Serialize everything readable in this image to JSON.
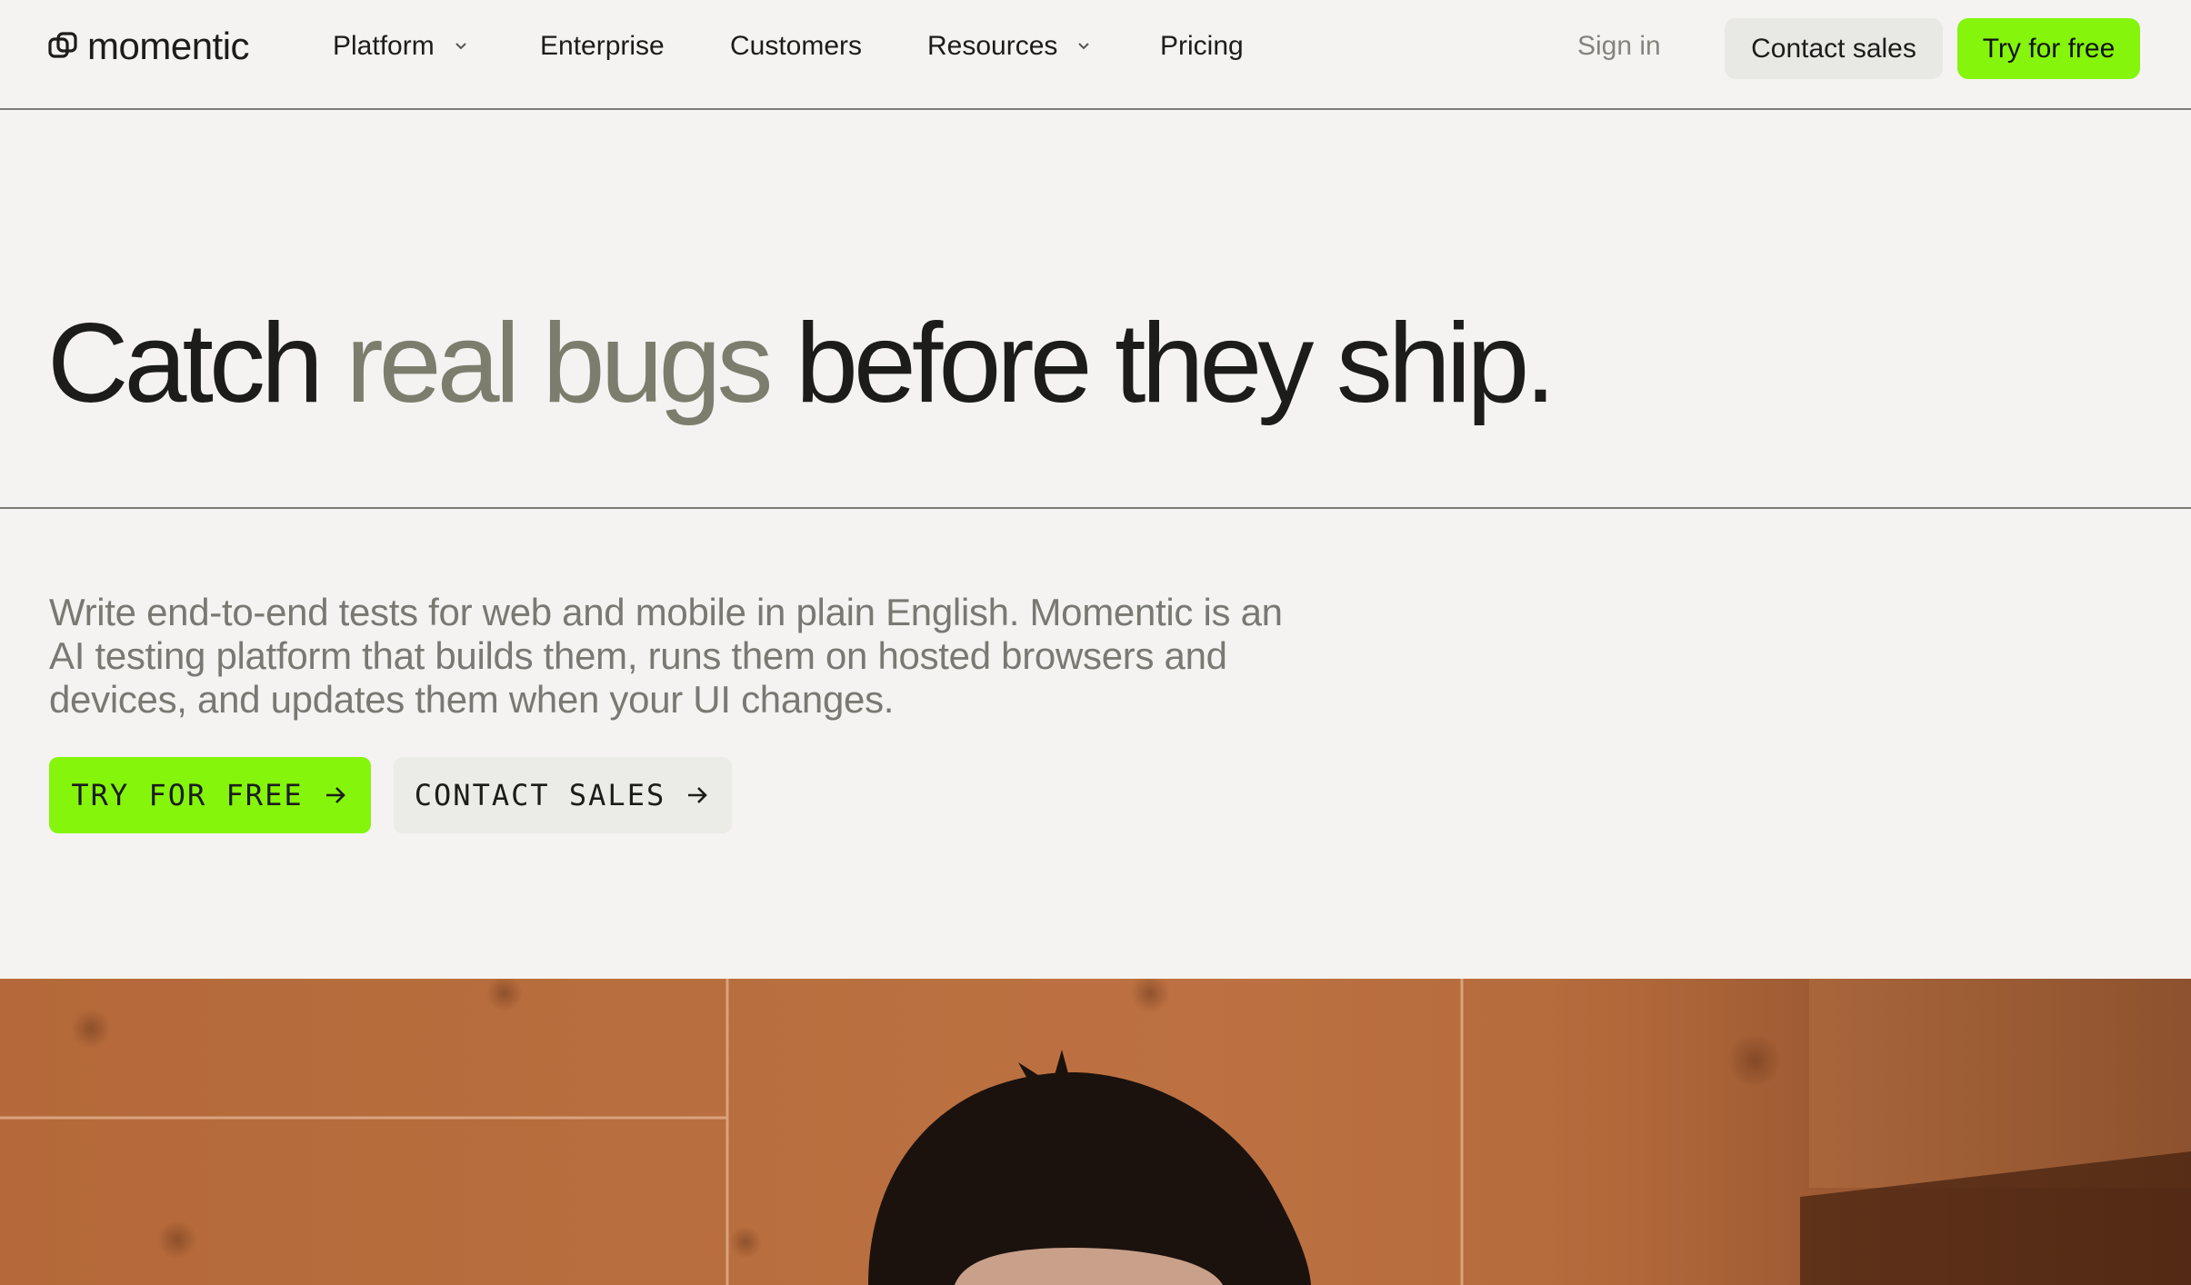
{
  "brand": {
    "name": "momentic",
    "icon": "momentic-logo-icon",
    "accent_color": "#84f50b"
  },
  "nav": {
    "items": [
      {
        "label": "Platform",
        "has_dropdown": true
      },
      {
        "label": "Enterprise",
        "has_dropdown": false
      },
      {
        "label": "Customers",
        "has_dropdown": false
      },
      {
        "label": "Resources",
        "has_dropdown": true
      },
      {
        "label": "Pricing",
        "has_dropdown": false
      }
    ],
    "sign_in": "Sign in",
    "contact_sales": "Contact sales",
    "try_free": "Try for free"
  },
  "hero": {
    "title_start": "Catch ",
    "title_highlight": "real bugs",
    "title_end": " before they ship.",
    "description": "Write end-to-end tests for web and mobile in plain English. Momentic is an AI testing platform that builds them, runs them on hosted browsers and devices, and updates them when your UI changes.",
    "cta_primary": "TRY FOR FREE",
    "cta_secondary": "CONTACT SALES"
  }
}
